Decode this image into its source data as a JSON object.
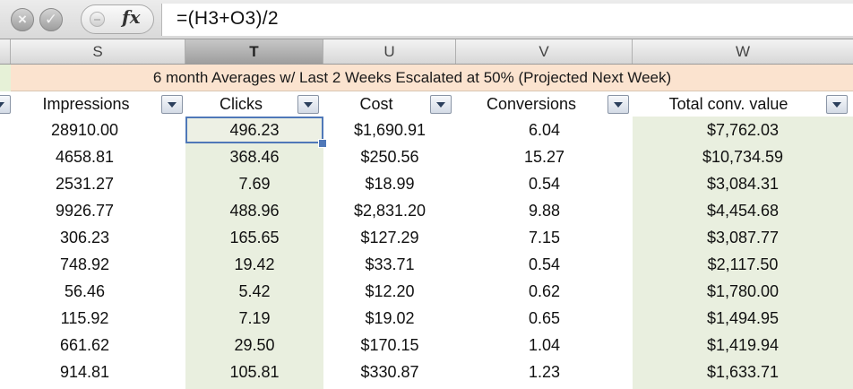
{
  "formula_bar": {
    "cancel_icon": "x-circle-icon",
    "enter_icon": "check-circle-icon",
    "fx_label": "fx",
    "formula": "=(H3+O3)/2"
  },
  "columns": [
    {
      "letter": "S",
      "label": "Impressions"
    },
    {
      "letter": "T",
      "label": "Clicks"
    },
    {
      "letter": "U",
      "label": "Cost"
    },
    {
      "letter": "V",
      "label": "Conversions"
    },
    {
      "letter": "W",
      "label": "Total conv. value"
    }
  ],
  "active_column": "T",
  "banner": "6 month Averages w/ Last 2 Weeks Escalated at 50% (Projected Next Week)",
  "colors": {
    "banner_bg": "#fbe3cf",
    "highlight_column_bg": "#e9efdf",
    "selection_border": "#4f78b8"
  },
  "rows": [
    [
      "28910.00",
      "496.23",
      "$1,690.91",
      "6.04",
      "$7,762.03"
    ],
    [
      "4658.81",
      "368.46",
      "$250.56",
      "15.27",
      "$10,734.59"
    ],
    [
      "2531.27",
      "7.69",
      "$18.99",
      "0.54",
      "$3,084.31"
    ],
    [
      "9926.77",
      "488.96",
      "$2,831.20",
      "9.88",
      "$4,454.68"
    ],
    [
      "306.23",
      "165.65",
      "$127.29",
      "7.15",
      "$3,087.77"
    ],
    [
      "748.92",
      "19.42",
      "$33.71",
      "0.54",
      "$2,117.50"
    ],
    [
      "56.46",
      "5.42",
      "$12.20",
      "0.62",
      "$1,780.00"
    ],
    [
      "115.92",
      "7.19",
      "$19.02",
      "0.65",
      "$1,494.95"
    ],
    [
      "661.62",
      "29.50",
      "$170.15",
      "1.04",
      "$1,419.94"
    ],
    [
      "914.81",
      "105.81",
      "$330.87",
      "1.23",
      "$1,633.71"
    ]
  ],
  "selected_cell": {
    "row": 0,
    "col": 1
  }
}
